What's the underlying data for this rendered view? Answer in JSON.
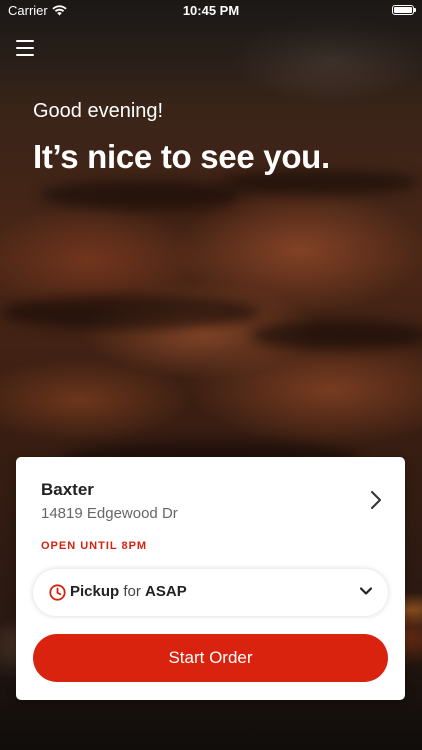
{
  "status_bar": {
    "carrier": "Carrier",
    "time": "10:45 PM"
  },
  "hero": {
    "greeting": "Good evening!",
    "headline": "It’s nice to see you."
  },
  "store": {
    "name": "Baxter",
    "address": "14819 Edgewood Dr",
    "hours": "OPEN UNTIL 8PM"
  },
  "order_mode": {
    "mode": "Pickup",
    "connector": "for",
    "time": "ASAP"
  },
  "actions": {
    "start_order": "Start Order"
  },
  "icons": {
    "menu": "hamburger-menu-icon",
    "wifi": "wifi-icon",
    "battery": "battery-icon",
    "chevron": "chevron-right-icon",
    "clock": "clock-icon",
    "caret": "chevron-down-icon"
  },
  "colors": {
    "brand_red": "#d9230e",
    "hours_red": "#d3230f"
  }
}
